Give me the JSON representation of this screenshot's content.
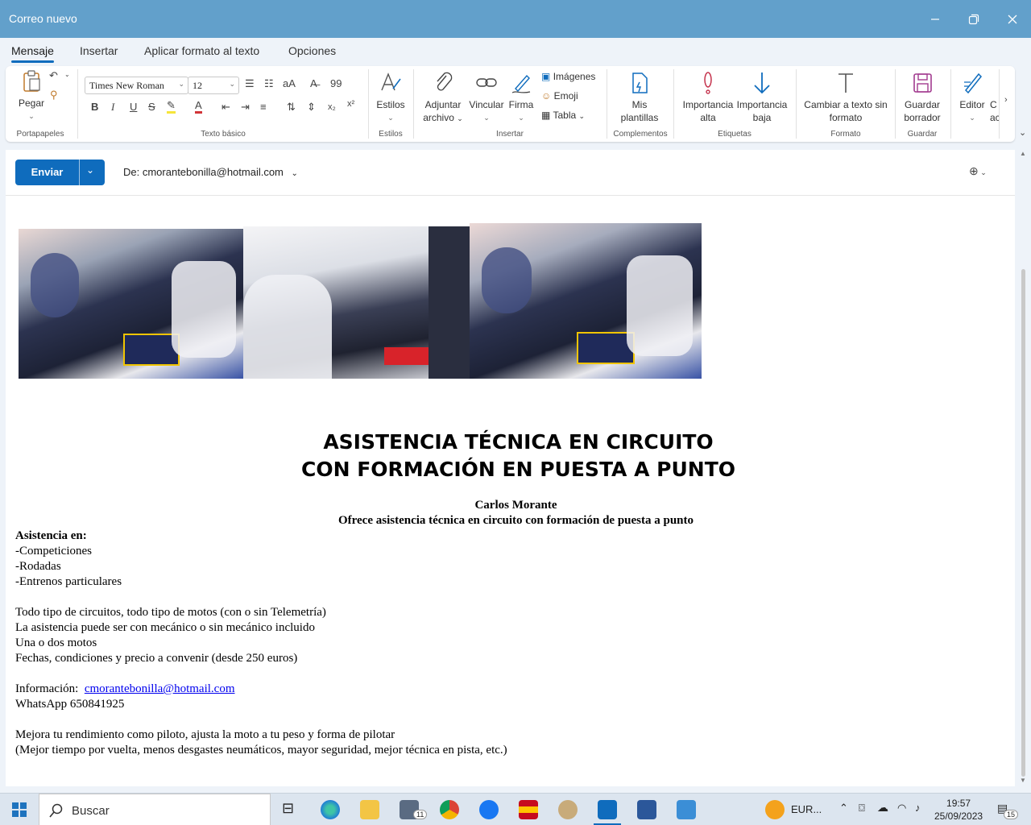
{
  "window": {
    "title": "Correo nuevo"
  },
  "tabs": [
    "Mensaje",
    "Insertar",
    "Aplicar formato al texto",
    "Opciones"
  ],
  "ribbon": {
    "paste_label": "Pegar",
    "font_name": "Times New Roman",
    "font_size": "12",
    "groups": {
      "portapapeles": "Portapapeles",
      "texto_basico": "Texto básico",
      "estilos": "Estilos",
      "insertar": "Insertar",
      "complementos": "Complementos",
      "etiquetas": "Etiquetas",
      "formato": "Formato",
      "guardar": "Guardar"
    },
    "estilos_label": "Estilos",
    "adjuntar_line1": "Adjuntar",
    "adjuntar_line2": "archivo",
    "vincular": "Vincular",
    "firma": "Firma",
    "imagenes": "Imágenes",
    "emoji": "Emoji",
    "tabla": "Tabla",
    "plantillas_line1": "Mis",
    "plantillas_line2": "plantillas",
    "imp_alta_line1": "Importancia",
    "imp_alta_line2": "alta",
    "imp_baja_line1": "Importancia",
    "imp_baja_line2": "baja",
    "cambiar_line1": "Cambiar a texto sin",
    "cambiar_line2": "formato",
    "guardar_line1": "Guardar",
    "guardar_line2": "borrador",
    "editor": "Editor",
    "overflow_line1": "C",
    "overflow_line2": "ac"
  },
  "compose": {
    "send_label": "Enviar",
    "from_label": "De: cmorantebonilla@hotmail.com"
  },
  "email": {
    "headline_line1": "ASISTENCIA TÉCNICA EN CIRCUITO",
    "headline_line2": "CON FORMACIÓN EN PUESTA A PUNTO",
    "name": "Carlos Morante",
    "tagline": "Ofrece asistencia técnica en circuito con formación de puesta a punto",
    "asistencia_header": "Asistencia en:",
    "asistencia_items": [
      "-Competiciones",
      "-Rodadas",
      "-Entrenos particulares"
    ],
    "details": [
      "Todo tipo de circuitos, todo tipo de motos (con o sin Telemetría)",
      "La asistencia puede ser con mecánico o sin mecánico incluido",
      "Una o dos motos",
      "Fechas, condiciones y precio a convenir (desde 250 euros)"
    ],
    "info_label": "Información:",
    "info_email": "cmorantebonilla@hotmail.com",
    "whatsapp": "WhatsApp  650841925",
    "closing_1": "Mejora tu rendimiento como piloto, ajusta la moto a tu peso y forma de pilotar",
    "closing_2": "(Mejor tiempo por vuelta, menos desgastes neumáticos, mayor seguridad, mejor técnica en pista, etc.)"
  },
  "taskbar": {
    "search_label": "Buscar",
    "mail_badge": "11",
    "weather": "EUR...",
    "time": "19:57",
    "date": "25/09/2023",
    "notif_count": "15"
  }
}
